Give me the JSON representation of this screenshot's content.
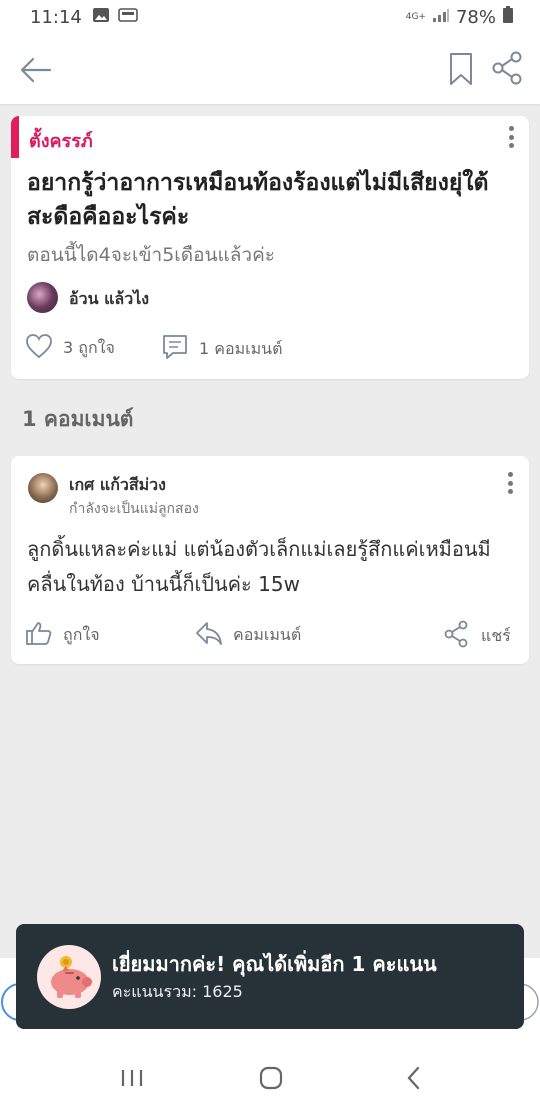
{
  "status_bar": {
    "time": "11:14",
    "network": "4G+",
    "battery": "78%"
  },
  "post": {
    "tag": "ตั้งครรภ์",
    "title": "อยากรู้ว่าอาการเหมือนท้องร้องแต่ไม่มีเสียงยุ่ใต้สะดือคืออะไรค่ะ",
    "subtitle": "ตอนนี้ได4จะเข้า5เดือนแล้วค่ะ",
    "author": "อ้วน แล้วไง",
    "likes": "3 ถูกใจ",
    "comments": "1 คอมเมนต์"
  },
  "comments_section": {
    "title": "1 คอมเมนต์"
  },
  "comment": {
    "name": "เกศ แก้วสีม่วง",
    "status": "กำลังจะเป็นแม่ลูกสอง",
    "body": "ลูกดิ้นแหละค่ะแม่ แต่น้องตัวเล็กแม่เลยรู้สึกแค่เหมือนมีคลื่นในท้อง บ้านนี้ก็เป็นค่ะ 15w",
    "like_label": "ถูกใจ",
    "reply_label": "คอมเมนต์",
    "share_label": "แชร์"
  },
  "toast": {
    "message": "เยี่ยมมากค่ะ! คุณได้เพิ่มอีก 1 คะแนน",
    "score": "คะแนนรวม: 1625"
  },
  "colors": {
    "accent": "#d81b60",
    "icon": "#7a8a99",
    "toast_bg": "#263238"
  }
}
